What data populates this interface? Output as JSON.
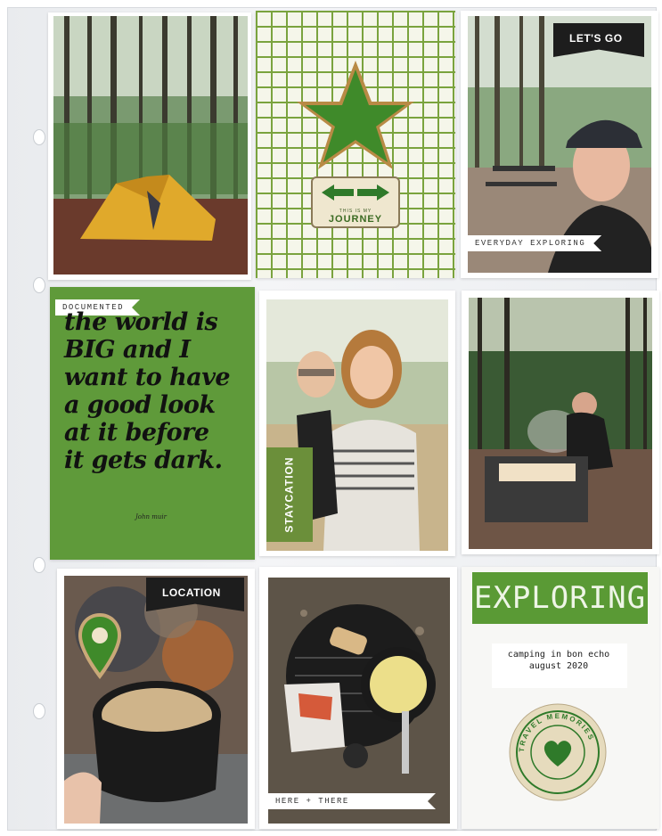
{
  "cards": {
    "tent": {
      "icon": "tent-photo"
    },
    "star_card": {
      "journey_small": "THIS IS MY",
      "journey_big": "JOURNEY",
      "icon": "double-arrow-icon"
    },
    "selfie": {
      "top_label": "LET'S GO",
      "bottom_label": "EVERYDAY EXPLORING"
    },
    "quote": {
      "tag": "DOCUMENTED",
      "text": "the world is BIG and I want to have a good look at it before it gets dark.",
      "author": "John muir"
    },
    "kids": {
      "label": "STAYCATION"
    },
    "fire": {
      "icon": "campfire-photo"
    },
    "coffee": {
      "label": "LOCATION",
      "icon": "map-pin-icon"
    },
    "food": {
      "label": "HERE + THERE"
    },
    "exploring": {
      "title": "EXPLORING",
      "note_line1": "camping in bon echo",
      "note_line2": "august 2020",
      "badge_text": "TRAVEL MEMORIES",
      "icon": "heart-icon"
    }
  },
  "colors": {
    "accent_green": "#5a9a35",
    "card_green": "#5f9a3a",
    "black_tab": "#1d1d1d",
    "kraft": "#e8dcc0"
  }
}
